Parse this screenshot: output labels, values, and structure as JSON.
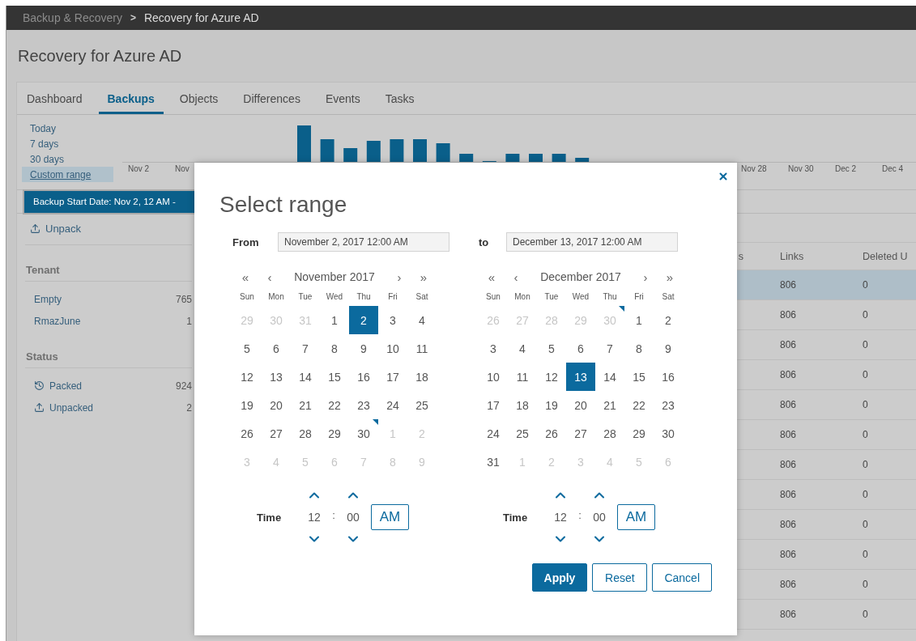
{
  "breadcrumb": {
    "parent": "Backup & Recovery",
    "separator": ">",
    "current": "Recovery for Azure AD"
  },
  "page_title": "Recovery for Azure AD",
  "tabs": [
    {
      "label": "Dashboard",
      "selected": false
    },
    {
      "label": "Backups",
      "selected": true
    },
    {
      "label": "Objects",
      "selected": false
    },
    {
      "label": "Differences",
      "selected": false
    },
    {
      "label": "Events",
      "selected": false
    },
    {
      "label": "Tasks",
      "selected": false
    }
  ],
  "ranges": [
    {
      "label": "Today",
      "selected": false
    },
    {
      "label": "7 days",
      "selected": false
    },
    {
      "label": "30 days",
      "selected": false
    },
    {
      "label": "Custom range",
      "selected": true
    }
  ],
  "chart": {
    "x_labels_start": [
      "Nov 2",
      "Nov"
    ],
    "x_labels_end": [
      "Nov 28",
      "Nov 30",
      "Dec 2",
      "Dec 4"
    ]
  },
  "filter_chip": "Backup Start Date: Nov 2, 12 AM -",
  "unpack_button": "Unpack",
  "sidebar": {
    "groups": [
      {
        "title": "Tenant",
        "items": [
          {
            "label": "Empty",
            "count": "765",
            "kind": "plain"
          },
          {
            "label": "RmazJune",
            "count": "1",
            "kind": "plain"
          }
        ]
      },
      {
        "title": "Status",
        "items": [
          {
            "label": "Packed",
            "count": "924",
            "kind": "packed"
          },
          {
            "label": "Unpacked",
            "count": "2",
            "kind": "unpacked"
          }
        ]
      }
    ]
  },
  "table": {
    "columns": [
      "s",
      "Links",
      "Deleted U"
    ],
    "rows": [
      {
        "cells": [
          "",
          "806",
          "0"
        ],
        "selected": true
      },
      {
        "cells": [
          "",
          "806",
          "0"
        ],
        "selected": false
      },
      {
        "cells": [
          "",
          "806",
          "0"
        ],
        "selected": false
      },
      {
        "cells": [
          "",
          "806",
          "0"
        ],
        "selected": false
      },
      {
        "cells": [
          "",
          "806",
          "0"
        ],
        "selected": false
      },
      {
        "cells": [
          "",
          "806",
          "0"
        ],
        "selected": false
      },
      {
        "cells": [
          "",
          "806",
          "0"
        ],
        "selected": false
      },
      {
        "cells": [
          "",
          "806",
          "0"
        ],
        "selected": false
      },
      {
        "cells": [
          "",
          "806",
          "0"
        ],
        "selected": false
      },
      {
        "cells": [
          "",
          "806",
          "0"
        ],
        "selected": false
      },
      {
        "cells": [
          "",
          "806",
          "0"
        ],
        "selected": false
      },
      {
        "cells": [
          "",
          "806",
          "0"
        ],
        "selected": false
      }
    ]
  },
  "dialog": {
    "title": "Select range",
    "calendars": [
      {
        "field": {
          "label": "From",
          "value": "November 2, 2017 12:00 AM"
        },
        "month": "November 2017",
        "nav": [
          "«",
          "‹",
          "›",
          "»"
        ],
        "weekdays": [
          "Sun",
          "Mon",
          "Tue",
          "Wed",
          "Thu",
          "Fri",
          "Sat"
        ],
        "days": [
          {
            "d": "29",
            "muted": true,
            "selected": false,
            "marked": false
          },
          {
            "d": "30",
            "muted": true,
            "selected": false,
            "marked": false
          },
          {
            "d": "31",
            "muted": true,
            "selected": false,
            "marked": false
          },
          {
            "d": "1",
            "muted": false,
            "selected": false,
            "marked": false
          },
          {
            "d": "2",
            "muted": false,
            "selected": true,
            "marked": false
          },
          {
            "d": "3",
            "muted": false,
            "selected": false,
            "marked": false
          },
          {
            "d": "4",
            "muted": false,
            "selected": false,
            "marked": false
          },
          {
            "d": "5",
            "muted": false,
            "selected": false,
            "marked": false
          },
          {
            "d": "6",
            "muted": false,
            "selected": false,
            "marked": false
          },
          {
            "d": "7",
            "muted": false,
            "selected": false,
            "marked": false
          },
          {
            "d": "8",
            "muted": false,
            "selected": false,
            "marked": false
          },
          {
            "d": "9",
            "muted": false,
            "selected": false,
            "marked": false
          },
          {
            "d": "10",
            "muted": false,
            "selected": false,
            "marked": false
          },
          {
            "d": "11",
            "muted": false,
            "selected": false,
            "marked": false
          },
          {
            "d": "12",
            "muted": false,
            "selected": false,
            "marked": false
          },
          {
            "d": "13",
            "muted": false,
            "selected": false,
            "marked": false
          },
          {
            "d": "14",
            "muted": false,
            "selected": false,
            "marked": false
          },
          {
            "d": "15",
            "muted": false,
            "selected": false,
            "marked": false
          },
          {
            "d": "16",
            "muted": false,
            "selected": false,
            "marked": false
          },
          {
            "d": "17",
            "muted": false,
            "selected": false,
            "marked": false
          },
          {
            "d": "18",
            "muted": false,
            "selected": false,
            "marked": false
          },
          {
            "d": "19",
            "muted": false,
            "selected": false,
            "marked": false
          },
          {
            "d": "20",
            "muted": false,
            "selected": false,
            "marked": false
          },
          {
            "d": "21",
            "muted": false,
            "selected": false,
            "marked": false
          },
          {
            "d": "22",
            "muted": false,
            "selected": false,
            "marked": false
          },
          {
            "d": "23",
            "muted": false,
            "selected": false,
            "marked": false
          },
          {
            "d": "24",
            "muted": false,
            "selected": false,
            "marked": false
          },
          {
            "d": "25",
            "muted": false,
            "selected": false,
            "marked": false
          },
          {
            "d": "26",
            "muted": false,
            "selected": false,
            "marked": false
          },
          {
            "d": "27",
            "muted": false,
            "selected": false,
            "marked": false
          },
          {
            "d": "28",
            "muted": false,
            "selected": false,
            "marked": false
          },
          {
            "d": "29",
            "muted": false,
            "selected": false,
            "marked": false
          },
          {
            "d": "30",
            "muted": false,
            "selected": false,
            "marked": true
          },
          {
            "d": "1",
            "muted": true,
            "selected": false,
            "marked": false
          },
          {
            "d": "2",
            "muted": true,
            "selected": false,
            "marked": false
          },
          {
            "d": "3",
            "muted": true,
            "selected": false,
            "marked": false
          },
          {
            "d": "4",
            "muted": true,
            "selected": false,
            "marked": false
          },
          {
            "d": "5",
            "muted": true,
            "selected": false,
            "marked": false
          },
          {
            "d": "6",
            "muted": true,
            "selected": false,
            "marked": false
          },
          {
            "d": "7",
            "muted": true,
            "selected": false,
            "marked": false
          },
          {
            "d": "8",
            "muted": true,
            "selected": false,
            "marked": false
          },
          {
            "d": "9",
            "muted": true,
            "selected": false,
            "marked": false
          }
        ],
        "time": {
          "label": "Time",
          "hour": "12",
          "separator": ":",
          "minute": "00",
          "period": "AM"
        }
      },
      {
        "field": {
          "label": "to",
          "value": "December 13, 2017 12:00 AM"
        },
        "month": "December 2017",
        "nav": [
          "«",
          "‹",
          "›",
          "»"
        ],
        "weekdays": [
          "Sun",
          "Mon",
          "Tue",
          "Wed",
          "Thu",
          "Fri",
          "Sat"
        ],
        "days": [
          {
            "d": "26",
            "muted": true,
            "selected": false,
            "marked": false
          },
          {
            "d": "27",
            "muted": true,
            "selected": false,
            "marked": false
          },
          {
            "d": "28",
            "muted": true,
            "selected": false,
            "marked": false
          },
          {
            "d": "29",
            "muted": true,
            "selected": false,
            "marked": false
          },
          {
            "d": "30",
            "muted": true,
            "selected": false,
            "marked": true
          },
          {
            "d": "1",
            "muted": false,
            "selected": false,
            "marked": false
          },
          {
            "d": "2",
            "muted": false,
            "selected": false,
            "marked": false
          },
          {
            "d": "3",
            "muted": false,
            "selected": false,
            "marked": false
          },
          {
            "d": "4",
            "muted": false,
            "selected": false,
            "marked": false
          },
          {
            "d": "5",
            "muted": false,
            "selected": false,
            "marked": false
          },
          {
            "d": "6",
            "muted": false,
            "selected": false,
            "marked": false
          },
          {
            "d": "7",
            "muted": false,
            "selected": false,
            "marked": false
          },
          {
            "d": "8",
            "muted": false,
            "selected": false,
            "marked": false
          },
          {
            "d": "9",
            "muted": false,
            "selected": false,
            "marked": false
          },
          {
            "d": "10",
            "muted": false,
            "selected": false,
            "marked": false
          },
          {
            "d": "11",
            "muted": false,
            "selected": false,
            "marked": false
          },
          {
            "d": "12",
            "muted": false,
            "selected": false,
            "marked": false
          },
          {
            "d": "13",
            "muted": false,
            "selected": true,
            "marked": false
          },
          {
            "d": "14",
            "muted": false,
            "selected": false,
            "marked": false
          },
          {
            "d": "15",
            "muted": false,
            "selected": false,
            "marked": false
          },
          {
            "d": "16",
            "muted": false,
            "selected": false,
            "marked": false
          },
          {
            "d": "17",
            "muted": false,
            "selected": false,
            "marked": false
          },
          {
            "d": "18",
            "muted": false,
            "selected": false,
            "marked": false
          },
          {
            "d": "19",
            "muted": false,
            "selected": false,
            "marked": false
          },
          {
            "d": "20",
            "muted": false,
            "selected": false,
            "marked": false
          },
          {
            "d": "21",
            "muted": false,
            "selected": false,
            "marked": false
          },
          {
            "d": "22",
            "muted": false,
            "selected": false,
            "marked": false
          },
          {
            "d": "23",
            "muted": false,
            "selected": false,
            "marked": false
          },
          {
            "d": "24",
            "muted": false,
            "selected": false,
            "marked": false
          },
          {
            "d": "25",
            "muted": false,
            "selected": false,
            "marked": false
          },
          {
            "d": "26",
            "muted": false,
            "selected": false,
            "marked": false
          },
          {
            "d": "27",
            "muted": false,
            "selected": false,
            "marked": false
          },
          {
            "d": "28",
            "muted": false,
            "selected": false,
            "marked": false
          },
          {
            "d": "29",
            "muted": false,
            "selected": false,
            "marked": false
          },
          {
            "d": "30",
            "muted": false,
            "selected": false,
            "marked": false
          },
          {
            "d": "31",
            "muted": false,
            "selected": false,
            "marked": false
          },
          {
            "d": "1",
            "muted": true,
            "selected": false,
            "marked": false
          },
          {
            "d": "2",
            "muted": true,
            "selected": false,
            "marked": false
          },
          {
            "d": "3",
            "muted": true,
            "selected": false,
            "marked": false
          },
          {
            "d": "4",
            "muted": true,
            "selected": false,
            "marked": false
          },
          {
            "d": "5",
            "muted": true,
            "selected": false,
            "marked": false
          },
          {
            "d": "6",
            "muted": true,
            "selected": false,
            "marked": false
          }
        ],
        "time": {
          "label": "Time",
          "hour": "12",
          "separator": ":",
          "minute": "00",
          "period": "AM"
        }
      }
    ],
    "buttons": [
      {
        "label": "Apply",
        "kind": "primary"
      },
      {
        "label": "Reset",
        "kind": "secondary"
      },
      {
        "label": "Cancel",
        "kind": "secondary"
      }
    ]
  }
}
